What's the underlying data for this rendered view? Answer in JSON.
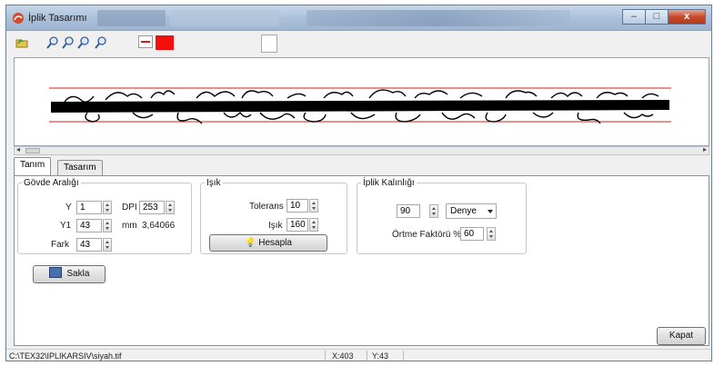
{
  "window": {
    "title": "İplik Tasarımı"
  },
  "window_controls": {
    "minimize": "–",
    "maximize": "□",
    "close": "x"
  },
  "tabs": [
    {
      "label": "Tanım"
    },
    {
      "label": "Tasarım"
    }
  ],
  "colors": {
    "thread_color": "#f40f0f",
    "guide_line": "#e01818"
  },
  "govde": {
    "legend": "Gövde Aralığı",
    "y_label": "Y",
    "y_value": "1",
    "y1_label": "Y1",
    "y1_value": "43",
    "fark_label": "Fark",
    "fark_value": "43",
    "dpi_label": "DPI",
    "dpi_value": "253",
    "mm_label": "mm",
    "mm_value": "3,64066"
  },
  "isik": {
    "legend": "Işık",
    "tolerans_label": "Tolerans",
    "tolerans_value": "10",
    "isik_label": "Işık",
    "isik_value": "160",
    "hesapla_label": "Hesapla"
  },
  "kalinlik": {
    "legend": "İplik Kalınlığı",
    "value": "90",
    "unit": "Denye",
    "ortme_label": "Örtme Faktörü %",
    "ortme_value": "60"
  },
  "buttons": {
    "sakla": "Sakla",
    "kapat": "Kapat"
  },
  "status": {
    "path": "C:\\TEX32\\IPLIKARSIV\\siyah.tif",
    "x": "X:403",
    "y": "Y:43"
  }
}
